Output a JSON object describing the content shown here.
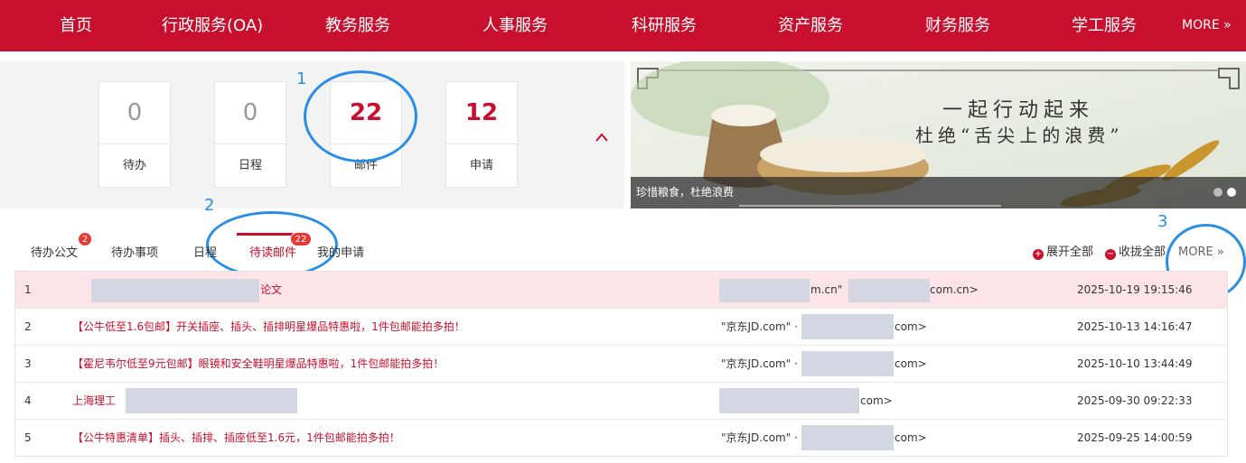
{
  "nav": {
    "items": [
      "首页",
      "行政服务(OA)",
      "教务服务",
      "人事服务",
      "科研服务",
      "资产服务",
      "财务服务",
      "学工服务"
    ],
    "more": "MORE »"
  },
  "stats": [
    {
      "value": "0",
      "label": "待办"
    },
    {
      "value": "0",
      "label": "日程"
    },
    {
      "value": "22",
      "label": "邮件"
    },
    {
      "value": "12",
      "label": "申请"
    }
  ],
  "collapse_icon": "caret-up-icon",
  "banner": {
    "headline_line1": "一起行动起来",
    "headline_line2": "杜绝“舌尖上的浪费”",
    "caption": "珍惜粮食，杜绝浪费"
  },
  "annotations": [
    "1",
    "2",
    "3"
  ],
  "tabs": [
    {
      "label": "待办公文",
      "badge": "2"
    },
    {
      "label": "待办事项",
      "badge": ""
    },
    {
      "label": "日程",
      "badge": ""
    },
    {
      "label": "待读邮件",
      "badge": "22",
      "active": true
    },
    {
      "label": "我的申请",
      "badge": ""
    }
  ],
  "toolbar": {
    "expand_all": "展开全部",
    "collapse_all": "收拢全部",
    "more": "MORE »"
  },
  "mails": [
    {
      "index": "1",
      "subject": "论文",
      "from_a": "m.cn\"",
      "from_b": "com.cn>",
      "time": "2025-10-19 19:15:46"
    },
    {
      "index": "2",
      "subject": "【公牛低至1.6包邮】开关插座、插头、插排明星爆品特惠啦，1件包邮能拍多拍！",
      "from_a": "\"京东JD.com\" ·",
      "from_b": "com>",
      "time": "2025-10-13 14:16:47"
    },
    {
      "index": "3",
      "subject": "【霍尼韦尔低至9元包邮】眼镜和安全鞋明星爆品特惠啦，1件包邮能拍多拍！",
      "from_a": "\"京东JD.com\" ·",
      "from_b": "com>",
      "time": "2025-10-10 13:44:49"
    },
    {
      "index": "4",
      "subject": "上海理工",
      "from_a": "",
      "from_b": "com>",
      "time": "2025-09-30 09:22:33"
    },
    {
      "index": "5",
      "subject": "【公牛特惠清单】插头、插排、插座低至1.6元，1件包邮能拍多拍！",
      "from_a": "\"京东JD.com\" ·",
      "from_b": "com>",
      "time": "2025-09-25 14:00:59"
    }
  ]
}
